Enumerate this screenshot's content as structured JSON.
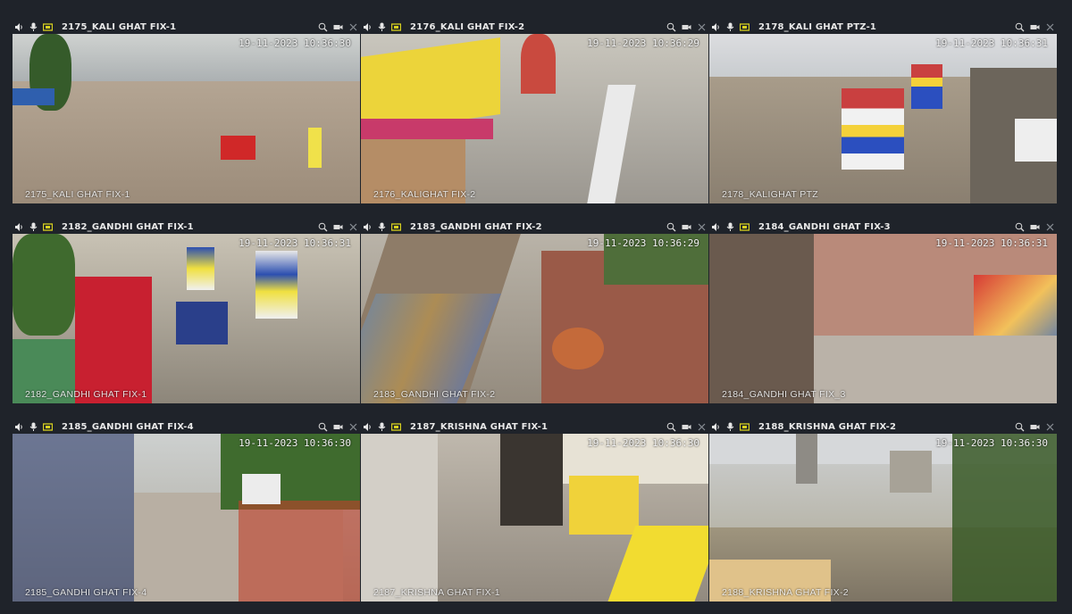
{
  "cameras": [
    {
      "title": "2175_KALI GHAT FIX-1",
      "timestamp": "19-11-2023 10:36:30",
      "overlay": "2175_KALI GHAT FIX-1"
    },
    {
      "title": "2176_KALI GHAT FIX-2",
      "timestamp": "19-11-2023 10:36:29",
      "overlay": "2176_KALIGHAT FIX-2"
    },
    {
      "title": "2178_KALI GHAT PTZ-1",
      "timestamp": "19-11-2023 10:36:31",
      "overlay": "2178_KALIGHAT PTZ"
    },
    {
      "title": "2182_GANDHI GHAT FIX-1",
      "timestamp": "19-11-2023 10:36:31",
      "overlay": "2182_GANDHI GHAT FIX-1"
    },
    {
      "title": "2183_GANDHI GHAT FIX-2",
      "timestamp": "19-11-2023 10:36:29",
      "overlay": "2183_GANDHI GHAT FIX-2"
    },
    {
      "title": "2184_GANDHI GHAT FIX-3",
      "timestamp": "19-11-2023 10:36:31",
      "overlay": "2184_GANDHI GHAT FIX_3"
    },
    {
      "title": "2185_GANDHI GHAT FIX-4",
      "timestamp": "19-11-2023 10:36:30",
      "overlay": "2185_GANDHI GHAT FIX-4"
    },
    {
      "title": "2187_KRISHNA GHAT FIX-1",
      "timestamp": "19-11-2023 10:36:30",
      "overlay": "2187_KRISHNA GHAT FIX-1"
    },
    {
      "title": "2188_KRISHNA GHAT FIX-2",
      "timestamp": "19-11-2023 10:36:30",
      "overlay": "2188_KRISHNA GHAT FIX-2"
    }
  ],
  "icons": {
    "header_left": [
      "speaker-icon",
      "microphone-icon",
      "recording-status-icon"
    ],
    "header_right": [
      "zoom-icon",
      "record-camera-icon",
      "close-icon"
    ]
  },
  "colors": {
    "background": "#1f232a",
    "header_text": "#e8e8e8",
    "recording_badge": "#d7d020"
  }
}
